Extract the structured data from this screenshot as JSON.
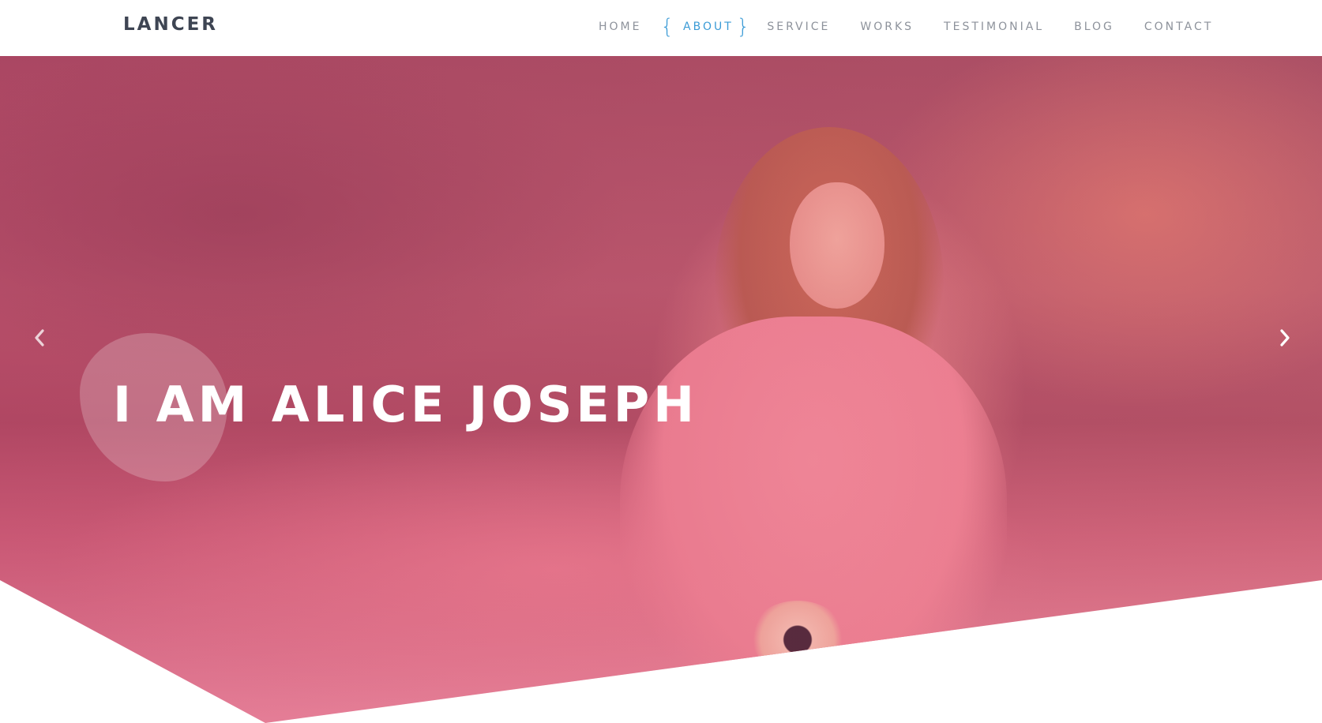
{
  "brand": {
    "logo_text": "LANCER"
  },
  "nav": {
    "items": [
      {
        "label": "HOME",
        "active": false
      },
      {
        "label": "ABOUT",
        "active": true
      },
      {
        "label": "SERVICE",
        "active": false
      },
      {
        "label": "WORKS",
        "active": false
      },
      {
        "label": "TESTIMONIAL",
        "active": false
      },
      {
        "label": "BLOG",
        "active": false
      },
      {
        "label": "CONTACT",
        "active": false
      }
    ],
    "active_brace_left": "{",
    "active_brace_right": "}"
  },
  "hero": {
    "title": "I AM ALICE JOSEPH",
    "prev_icon": "chevron-left-icon",
    "next_icon": "chevron-right-icon"
  },
  "colors": {
    "accent": "#3b9bd6",
    "nav_text": "#8d929b",
    "logo": "#3e4553",
    "hero_overlay": "#e8758f"
  }
}
